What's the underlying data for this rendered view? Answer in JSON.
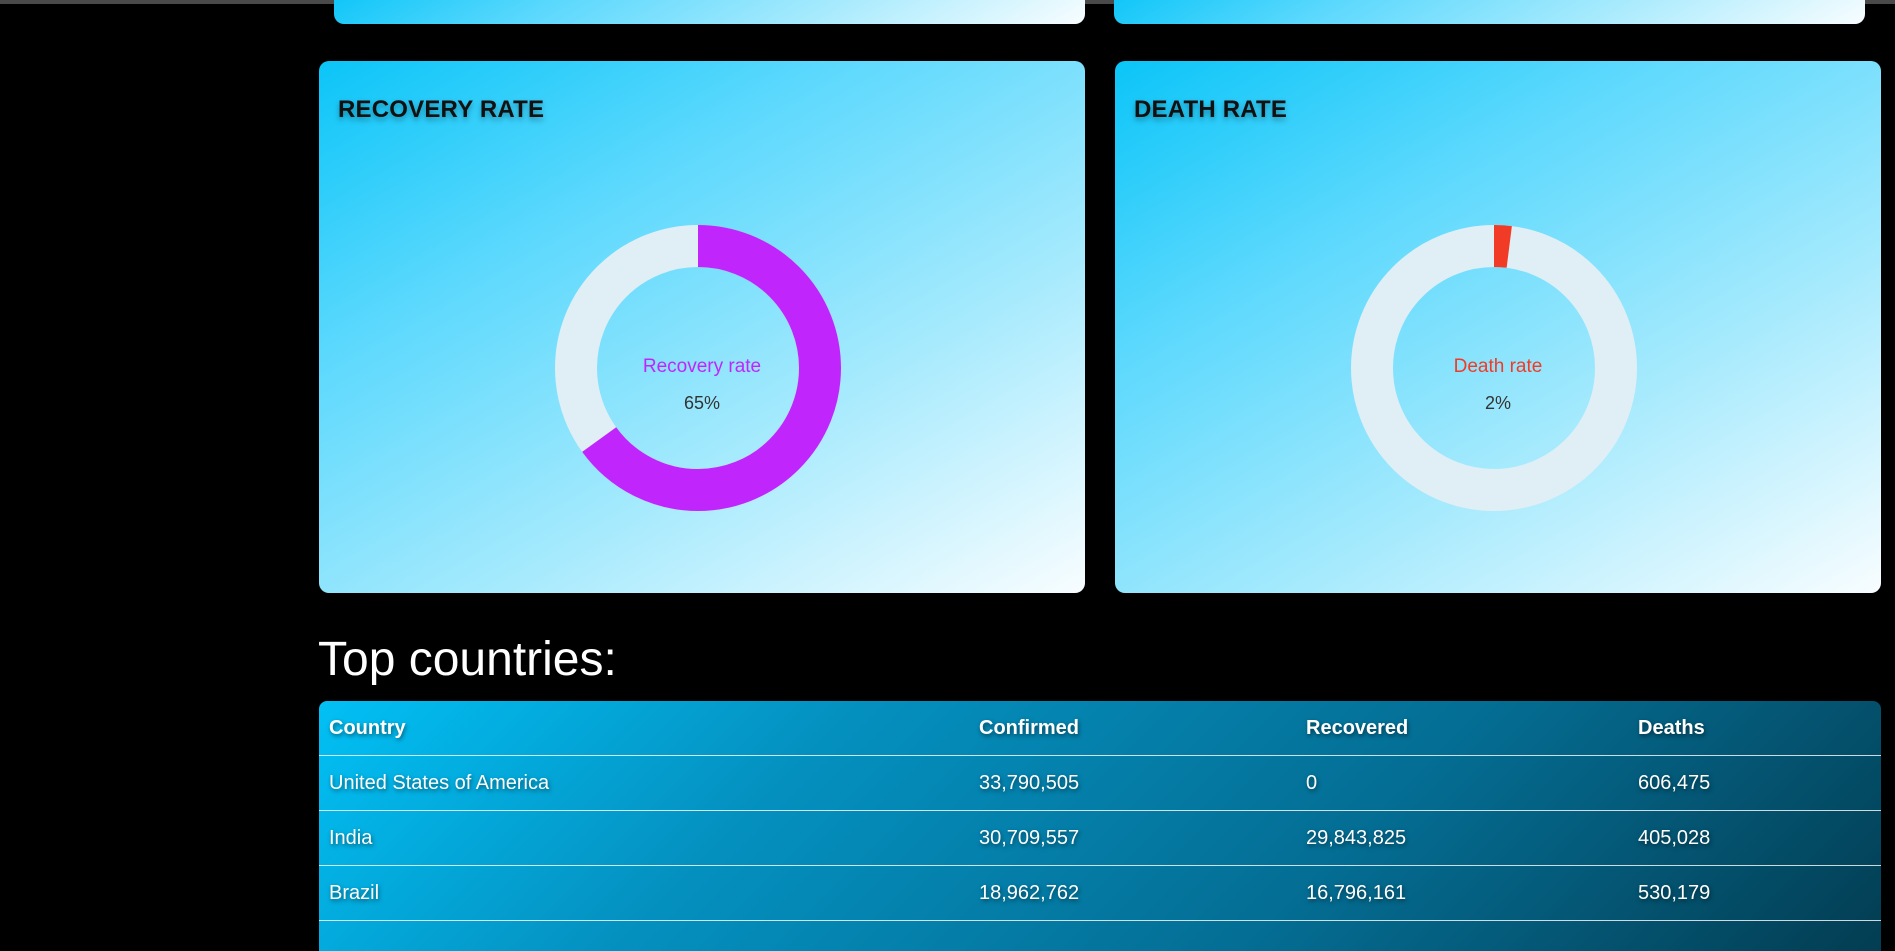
{
  "cards": {
    "recovery": {
      "title": "RECOVERY RATE",
      "label": "Recovery rate",
      "value_text": "65%",
      "fraction": 0.65,
      "color": "#c026fc",
      "track_color": "#dfeff5"
    },
    "death": {
      "title": "DEATH RATE",
      "label": "Death rate",
      "value_text": "2%",
      "fraction": 0.02,
      "color": "#f23b26",
      "track_color": "#dfeff5"
    }
  },
  "top_countries": {
    "title": "Top countries:",
    "headers": [
      "Country",
      "Confirmed",
      "Recovered",
      "Deaths"
    ],
    "rows": [
      [
        "United States of America",
        "33,790,505",
        "0",
        "606,475"
      ],
      [
        "India",
        "30,709,557",
        "29,843,825",
        "405,028"
      ],
      [
        "Brazil",
        "18,962,762",
        "16,796,161",
        "530,179"
      ]
    ]
  }
}
